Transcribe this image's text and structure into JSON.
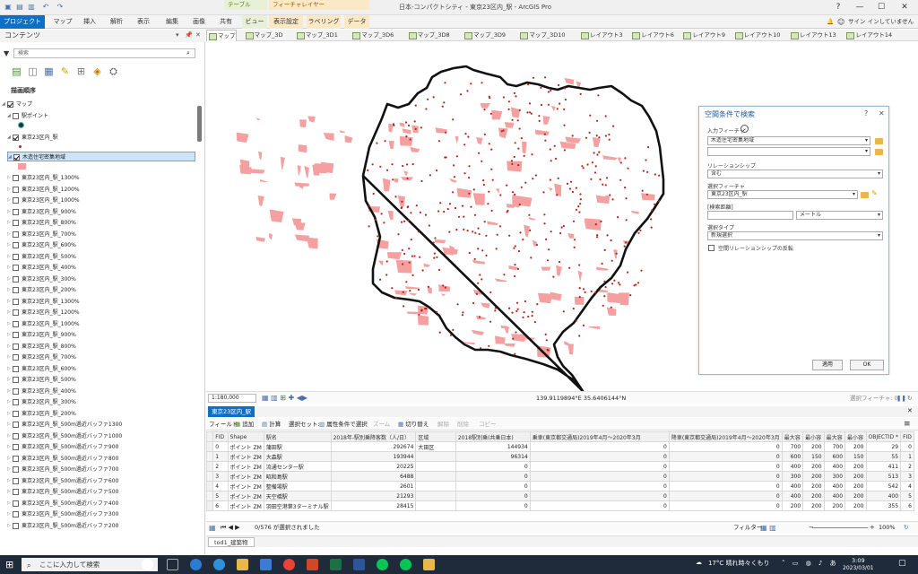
{
  "title_bar": {
    "app_title": "日本-コンパクトシティ - 東京23区内_駅 - ArcGIS Pro",
    "context_table": "テーブル",
    "context_feature_layer": "フィーチャレイヤー",
    "help": "?",
    "minimize": "—",
    "maximize": "☐",
    "close": "✕"
  },
  "ribbon": {
    "tabs": [
      "プロジェクト",
      "マップ",
      "挿入",
      "解析",
      "表示",
      "編集",
      "画像",
      "共有",
      "ビュー",
      "表示設定",
      "ラベリング",
      "データ"
    ],
    "active_tab": "プロジェクト",
    "signin": "サイン インしていません ▾",
    "notification_icon": "bell-icon",
    "smile_icon": "smile-icon"
  },
  "contents_pane": {
    "title": "コンテンツ",
    "search_placeholder": "検索",
    "draw_order": "描画順序",
    "layers": [
      {
        "name": "マップ",
        "checked": true,
        "level": 0
      },
      {
        "name": "駅ポイント",
        "checked": false,
        "level": 1
      },
      {
        "name": "東京23区内_駅",
        "checked": true,
        "level": 1
      },
      {
        "name": "木造住宅密集地域",
        "checked": true,
        "level": 1,
        "selected": true
      },
      {
        "name": "東京23区内_駅_1300%",
        "checked": false,
        "level": 1
      },
      {
        "name": "東京23区内_駅_1200%",
        "checked": false,
        "level": 1
      },
      {
        "name": "東京23区内_駅_1000%",
        "checked": false,
        "level": 1
      },
      {
        "name": "東京23区内_駅_900%",
        "checked": false,
        "level": 1
      },
      {
        "name": "東京23区内_駅_800%",
        "checked": false,
        "level": 1
      },
      {
        "name": "東京23区内_駅_700%",
        "checked": false,
        "level": 1
      },
      {
        "name": "東京23区内_駅_600%",
        "checked": false,
        "level": 1
      },
      {
        "name": "東京23区内_駅_500%",
        "checked": false,
        "level": 1
      },
      {
        "name": "東京23区内_駅_400%",
        "checked": false,
        "level": 1
      },
      {
        "name": "東京23区内_駅_300%",
        "checked": false,
        "level": 1
      },
      {
        "name": "東京23区内_駅_200%",
        "checked": false,
        "level": 1
      },
      {
        "name": "東京23区内_駅_1300%",
        "checked": false,
        "level": 1
      },
      {
        "name": "東京23区内_駅_1200%",
        "checked": false,
        "level": 1
      },
      {
        "name": "東京23区内_駅_1000%",
        "checked": false,
        "level": 1
      },
      {
        "name": "東京23区内_駅_900%",
        "checked": false,
        "level": 1
      },
      {
        "name": "東京23区内_駅_800%",
        "checked": false,
        "level": 1
      },
      {
        "name": "東京23区内_駅_700%",
        "checked": false,
        "level": 1
      },
      {
        "name": "東京23区内_駅_600%",
        "checked": false,
        "level": 1
      },
      {
        "name": "東京23区内_駅_500%",
        "checked": false,
        "level": 1
      },
      {
        "name": "東京23区内_駅_400%",
        "checked": false,
        "level": 1
      },
      {
        "name": "東京23区内_駅_300%",
        "checked": false,
        "level": 1
      },
      {
        "name": "東京23区内_駅_200%",
        "checked": false,
        "level": 1
      },
      {
        "name": "東京23区内_駅_500m過近バッファ1300",
        "checked": false,
        "level": 1
      },
      {
        "name": "東京23区内_駅_500m過近バッファ1000",
        "checked": false,
        "level": 1
      },
      {
        "name": "東京23区内_駅_500m過近バッファ900",
        "checked": false,
        "level": 1
      },
      {
        "name": "東京23区内_駅_500m過近バッファ800",
        "checked": false,
        "level": 1
      },
      {
        "name": "東京23区内_駅_500m過近バッファ700",
        "checked": false,
        "level": 1
      },
      {
        "name": "東京23区内_駅_500m過近バッファ600",
        "checked": false,
        "level": 1
      },
      {
        "name": "東京23区内_駅_500m過近バッファ500",
        "checked": false,
        "level": 1
      },
      {
        "name": "東京23区内_駅_500m過近バッファ400",
        "checked": false,
        "level": 1
      },
      {
        "name": "東京23区内_駅_500m過近バッファ300",
        "checked": false,
        "level": 1
      },
      {
        "name": "東京23区内_駅_500m過近バッファ200",
        "checked": false,
        "level": 1
      }
    ]
  },
  "map_tabs": [
    "マップ",
    "マップ_3D",
    "マップ_3D1",
    "マップ_3D6",
    "マップ_3D8",
    "マップ_3D9",
    "マップ_3D10",
    "レイアウト3",
    "レイアウト6",
    "レイアウト9",
    "レイアウト10",
    "レイアウト13",
    "レイアウト14"
  ],
  "map_status": {
    "scale": "1:180,000",
    "coordinates": "139.9119894°E 35.6406144°N",
    "selected_features": "選択フィーチャ: 0"
  },
  "colors": {
    "accent": "#0e6fc6",
    "dense_area": "#f4a0a0",
    "station": "#b3261e",
    "boundary": "#111111"
  },
  "select_by_location": {
    "title": "空間条件で検索",
    "input_label": "入力フィーチャ",
    "input_value": "木造住宅密集地域",
    "input_value_2": "",
    "relationship_label": "リレーションシップ",
    "relationship_value": "含む",
    "selecting_label": "選択フィーチャ",
    "selecting_value": "東京23区内_駅",
    "distance_label": "[検索距離]",
    "distance_unit": "メートル",
    "selection_type_label": "選択タイプ",
    "selection_type_value": "新規選択",
    "invert_label": "空間リレーションシップの反転",
    "apply": "適用",
    "ok": "OK"
  },
  "table": {
    "tab_label": "東京23区内_駅",
    "toolbar": {
      "field_label": "フィールド:",
      "add": "追加",
      "calculate": "計算",
      "selection_label": "選択セット:",
      "select_by_attr": "属性条件で選択",
      "zoom": "ズーム",
      "switch": "切り替え",
      "clear": "解除",
      "delete": "削除",
      "copy": "コピー"
    },
    "columns": [
      "FID",
      "Shape",
      "駅名",
      "2018年-駅別乗降客数（人/日）",
      "区域",
      "2018駅別乗(共乗日本)",
      "乗車(東京都交通局)2019年4月～2020年3月",
      "降車(東京都交通局)2019年4月～2020年3月",
      "最大容",
      "最小容",
      "最大容",
      "最小容",
      "OBJECTID *",
      "FID"
    ],
    "rows": [
      [
        "0",
        "ポイント ZM",
        "蒲田駅",
        "292674",
        "大田区",
        "144934",
        "0",
        "0",
        "700",
        "200",
        "700",
        "200",
        "29",
        "0"
      ],
      [
        "1",
        "ポイント ZM",
        "大森駅",
        "193944",
        "",
        "96314",
        "0",
        "0",
        "600",
        "150",
        "600",
        "150",
        "55",
        "1"
      ],
      [
        "2",
        "ポイント ZM",
        "流通センター駅",
        "20225",
        "",
        "0",
        "0",
        "0",
        "400",
        "200",
        "400",
        "200",
        "411",
        "2"
      ],
      [
        "3",
        "ポイント ZM",
        "昭和島駅",
        "6488",
        "",
        "0",
        "0",
        "0",
        "300",
        "200",
        "300",
        "200",
        "513",
        "3"
      ],
      [
        "4",
        "ポイント ZM",
        "整備場駅",
        "2601",
        "",
        "0",
        "0",
        "0",
        "400",
        "200",
        "400",
        "200",
        "542",
        "4"
      ],
      [
        "5",
        "ポイント ZM",
        "天空橋駅",
        "21293",
        "",
        "0",
        "0",
        "0",
        "400",
        "200",
        "400",
        "200",
        "400",
        "5"
      ],
      [
        "6",
        "ポイント ZM",
        "羽田空港第3ターミナル駅",
        "28415",
        "",
        "0",
        "0",
        "0",
        "200",
        "200",
        "200",
        "200",
        "355",
        "6"
      ]
    ],
    "footer_selected": "0/576 が選択されました",
    "filter_label": "フィルター:",
    "zoom_percent": "100%"
  },
  "bottom_tab": "tod1_建築物",
  "taskbar": {
    "search_placeholder": "ここに入力して検索",
    "weather": "17°C 晴れ時々くもり",
    "time": "3:09",
    "date": "2023/03/01"
  }
}
